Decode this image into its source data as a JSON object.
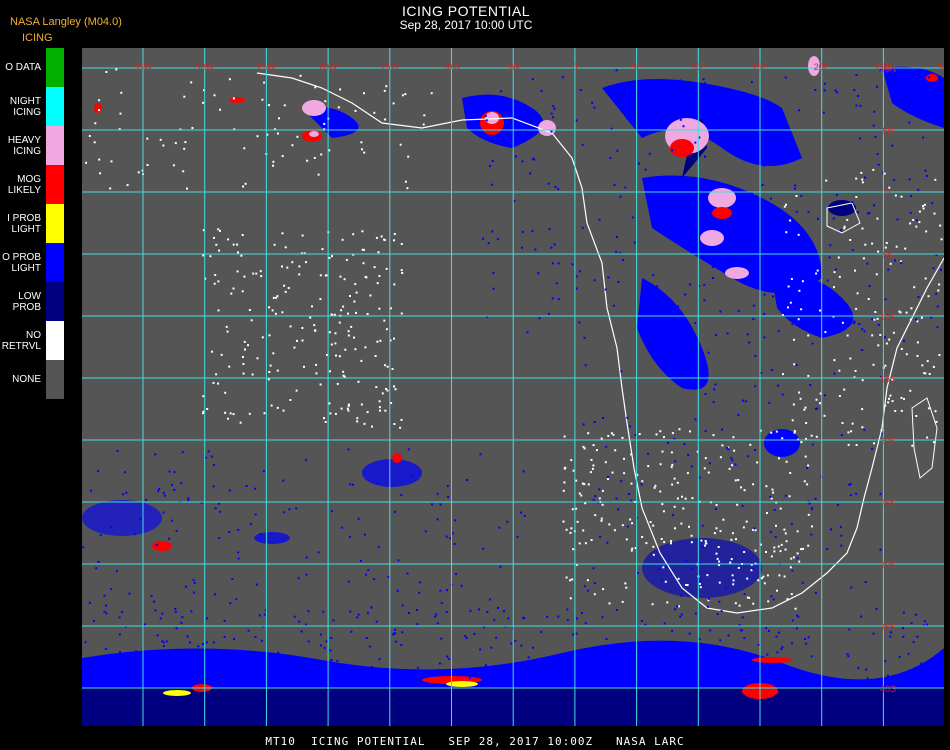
{
  "header": {
    "producer": "NASA Langley (M04.0)",
    "product_label": "ICING",
    "title": "ICING POTENTIAL",
    "subtitle": "Sep 28, 2017 10:00 UTC"
  },
  "legend": {
    "items": [
      {
        "label": "O DATA",
        "color": "#00b000"
      },
      {
        "label": "NIGHT\nICING",
        "color": "#00ffff"
      },
      {
        "label": "HEAVY\nICING",
        "color": "#f0a8e0"
      },
      {
        "label": "MOG\nLIKELY",
        "color": "#ff0000"
      },
      {
        "label": "I PROB\nLIGHT",
        "color": "#ffff00"
      },
      {
        "label": "O PROB\nLIGHT",
        "color": "#0000ff"
      },
      {
        "label": "LOW\nPROB",
        "color": "#000080"
      },
      {
        "label": "NO\nRETRVL",
        "color": "#ffffff"
      },
      {
        "label": "NONE",
        "color": "#555555"
      }
    ]
  },
  "map": {
    "background_color": "#555555",
    "grid_color": "#40e0e0",
    "coast_color": "#ffffff",
    "longitude_labels": [
      "35W",
      "30W",
      "25W",
      "20W",
      "15W",
      "10W",
      "5W",
      "0",
      "5E",
      "10E",
      "15E",
      "20E",
      "25E",
      "30E"
    ],
    "latitude_labels": [
      "10N",
      "5N",
      "0",
      "5S",
      "10S",
      "15S",
      "20S",
      "25S",
      "30S",
      "35S",
      "40S",
      "45S"
    ]
  },
  "footer": {
    "text": "MT10  ICING POTENTIAL   SEP 28, 2017 10:00Z   NASA LARC"
  }
}
